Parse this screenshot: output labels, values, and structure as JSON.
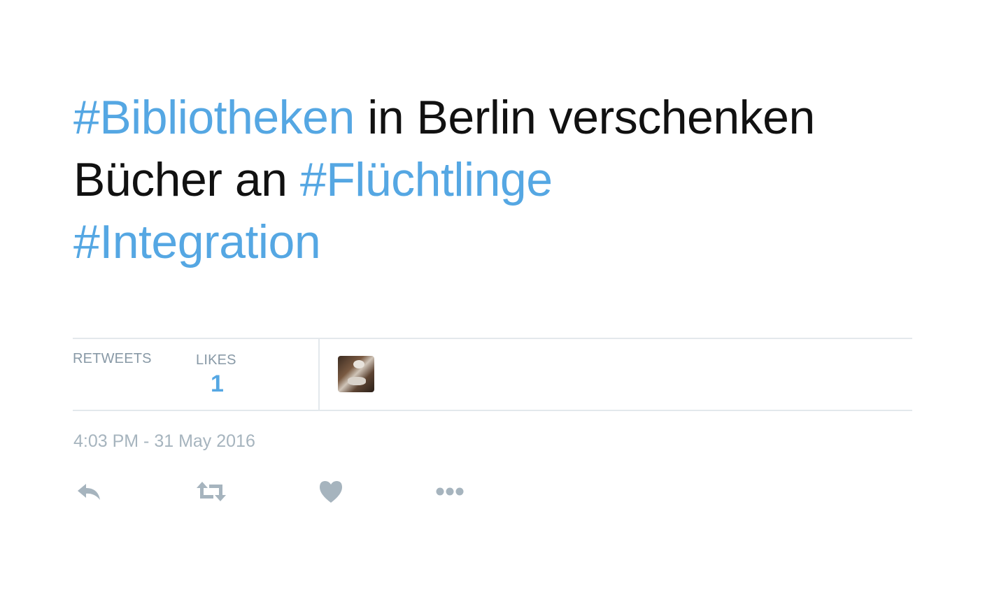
{
  "tweet": {
    "line1": {
      "hashtag": "#Bibliotheken",
      "text": " in Berlin verschenken"
    },
    "line2": {
      "text": "Bücher an ",
      "hashtag": "#Flüchtlinge"
    },
    "line3": {
      "hashtag": "#Integration"
    }
  },
  "stats": {
    "retweets_label": "RETWEETS",
    "likes_label": "LIKES",
    "likes_count": "1"
  },
  "timestamp": "4:03 PM - 31 May 2016",
  "actions": [
    {
      "name": "reply",
      "icon": "reply-icon"
    },
    {
      "name": "retweet",
      "icon": "retweet-icon"
    },
    {
      "name": "like",
      "icon": "heart-icon"
    },
    {
      "name": "more",
      "icon": "more-dots-icon"
    }
  ],
  "colors": {
    "hashtag": "#55a7e3",
    "text": "#111111",
    "muted": "#8899a6",
    "icon": "#a6b4be",
    "divider": "#e3e8ec"
  }
}
